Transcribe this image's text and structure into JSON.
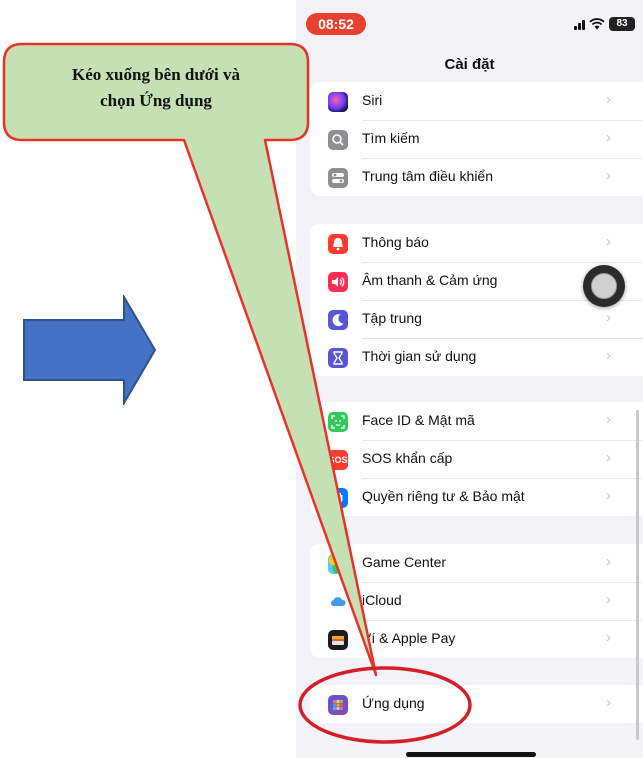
{
  "status_bar": {
    "time": "08:52",
    "battery": "83"
  },
  "nav": {
    "title": "Cài đặt"
  },
  "groups": [
    {
      "items": [
        {
          "label": "Siri",
          "icon": "siri-icon"
        },
        {
          "label": "Tìm kiếm",
          "icon": "search-icon"
        },
        {
          "label": "Trung tâm điều khiển",
          "icon": "control-center-icon"
        }
      ]
    },
    {
      "items": [
        {
          "label": "Thông báo",
          "icon": "notifications-icon"
        },
        {
          "label": "Âm thanh & Cảm ứng",
          "icon": "sound-icon"
        },
        {
          "label": "Tập trung",
          "icon": "focus-moon-icon"
        },
        {
          "label": "Thời gian sử dụng",
          "icon": "hourglass-icon"
        }
      ]
    },
    {
      "items": [
        {
          "label": "Face ID & Mật mã",
          "icon": "face-id-icon"
        },
        {
          "label": "SOS khẩn cấp",
          "icon": "sos-icon",
          "icon_text": "SOS"
        },
        {
          "label": "Quyền riêng tư & Bảo mật",
          "icon": "privacy-hand-icon"
        }
      ]
    },
    {
      "items": [
        {
          "label": "Game Center",
          "icon": "game-center-icon"
        },
        {
          "label": "iCloud",
          "icon": "icloud-icon"
        },
        {
          "label": "Ví & Apple Pay",
          "icon": "wallet-icon"
        }
      ]
    },
    {
      "items": [
        {
          "label": "Ứng dụng",
          "icon": "apps-grid-icon"
        }
      ]
    }
  ],
  "callout": {
    "line1": "Kéo xuống bên dưới và",
    "line2": "chọn Ứng dụng"
  },
  "colors": {
    "callout_fill": "#c5e0b3",
    "callout_border": "#e8332a",
    "arrow_fill": "#4472c4",
    "highlight": "#d41f2a"
  }
}
